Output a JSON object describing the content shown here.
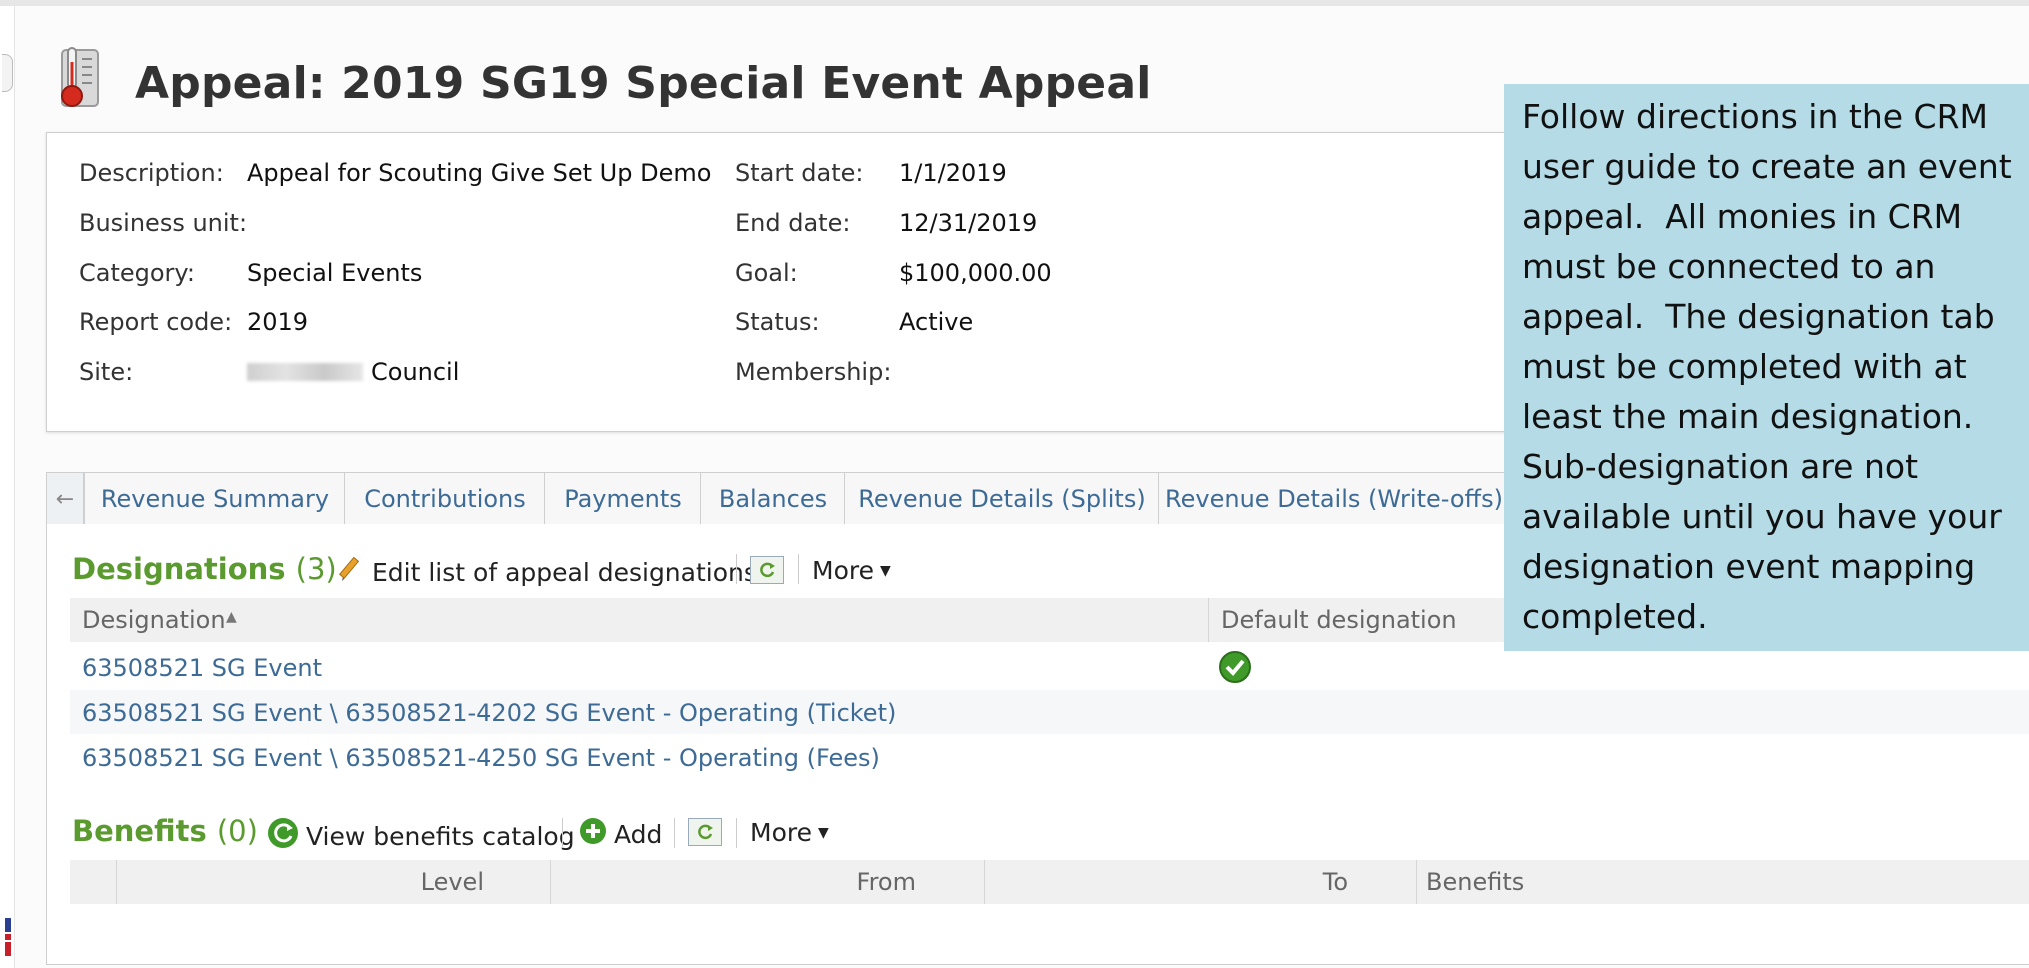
{
  "header": {
    "title": "Appeal: 2019 SG19 Special Event Appeal",
    "icon": "thermometer-icon"
  },
  "details": {
    "description_label": "Description:",
    "description_value": "Appeal for Scouting Give Set Up Demo",
    "business_unit_label": "Business unit:",
    "business_unit_value": "",
    "category_label": "Category:",
    "category_value": "Special Events",
    "report_code_label": "Report code:",
    "report_code_value": "2019",
    "site_label": "Site:",
    "site_value": "Council",
    "start_date_label": "Start date:",
    "start_date_value": "1/1/2019",
    "end_date_label": "End date:",
    "end_date_value": "12/31/2019",
    "goal_label": "Goal:",
    "goal_value": "$100,000.00",
    "status_label": "Status:",
    "status_value": "Active",
    "membership_label": "Membership:",
    "membership_value": ""
  },
  "tabs": [
    {
      "label": "Revenue Summary"
    },
    {
      "label": "Contributions"
    },
    {
      "label": "Payments"
    },
    {
      "label": "Balances"
    },
    {
      "label": "Revenue Details (Splits)"
    },
    {
      "label": "Revenue Details (Write-offs)"
    }
  ],
  "designations": {
    "title": "Designations",
    "count": "(3)",
    "edit_label": "Edit list of appeal designations",
    "more_label": "More",
    "columns": [
      "Designation",
      "Default designation"
    ],
    "rows": [
      {
        "designation": "63508521 SG Event",
        "is_default": true
      },
      {
        "designation": "63508521 SG Event \\ 63508521-4202 SG Event - Operating (Ticket)",
        "is_default": false
      },
      {
        "designation": "63508521 SG Event \\ 63508521-4250 SG Event - Operating (Fees)",
        "is_default": false
      }
    ]
  },
  "benefits": {
    "title": "Benefits",
    "count": "(0)",
    "view_catalog_label": "View benefits catalog",
    "add_label": "Add",
    "more_label": "More",
    "columns": [
      "Level",
      "From",
      "To",
      "Benefits"
    ]
  },
  "callout": {
    "text": "Follow directions in the CRM user guide to create an event appeal.  All monies in CRM must be connected to an appeal.  The designation tab must be completed with at least the main designation.  Sub-designation are not available until you have your designation event mapping completed."
  },
  "colors": {
    "accent_green": "#5a9a2f",
    "link_blue": "#3d6b96",
    "callout_bg": "#b5dbe6"
  }
}
